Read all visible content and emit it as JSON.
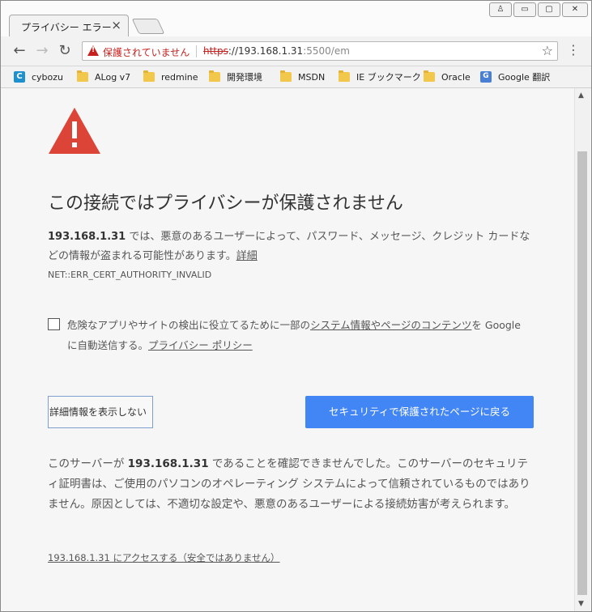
{
  "tab": {
    "title": "プライバシー エラー",
    "close": "×"
  },
  "window_controls": {
    "user": "♙",
    "minimize": "▭",
    "maximize": "▢",
    "close": "✕"
  },
  "toolbar": {
    "back": "←",
    "forward": "→",
    "reload": "↻",
    "security_label": "保護されていません",
    "url_scheme": "https",
    "url_sep": "://",
    "url_host": "193.168.1.31",
    "url_path": ":5500/em",
    "bookmark_star": "☆",
    "menu": "⋮"
  },
  "bookmarks": [
    {
      "label": "cybozu",
      "icon": "cybozu-icon"
    },
    {
      "label": "ALog v7",
      "icon": "folder-icon"
    },
    {
      "label": "redmine",
      "icon": "folder-icon"
    },
    {
      "label": "開発環境",
      "icon": "folder-icon"
    },
    {
      "label": "MSDN",
      "icon": "folder-icon"
    },
    {
      "label": "IE ブックマーク",
      "icon": "folder-icon"
    },
    {
      "label": "Oracle",
      "icon": "folder-icon"
    },
    {
      "label": "Google 翻訳",
      "icon": "google-translate-icon"
    }
  ],
  "interstitial": {
    "heading": "この接続ではプライバシーが保護されません",
    "host": "193.168.1.31",
    "desc_part": " では、悪意のあるユーザーによって、パスワード、メッセージ、クレジット カードなどの情報が盗まれる可能性があります。",
    "details_link": "詳細",
    "error_code": "NET::ERR_CERT_AUTHORITY_INVALID",
    "checkbox_text_1": "危険なアプリやサイトの検出に役立てるために一部の",
    "checkbox_link_1": "システム情報やページのコンテンツ",
    "checkbox_text_2": "を Google に自動送信する。",
    "checkbox_link_2": "プライバシー ポリシー",
    "hide_details_button": "詳細情報を表示しない",
    "back_button": "セキュリティで保護されたページに戻る",
    "explain_1": "このサーバーが ",
    "explain_host": "193.168.1.31",
    "explain_2": " であることを確認できませんでした。このサーバーのセキュリティ証明書は、ご使用のパソコンのオペレーティング システムによって信頼されているものではありません。原因としては、不適切な設定や、悪意のあるユーザーによる接続妨害が考えられます。",
    "proceed_link": "193.168.1.31 にアクセスする（安全ではありません）"
  },
  "colors": {
    "warning_red": "#c5221f",
    "primary_blue": "#4285f4",
    "big_warning": "#db4437"
  }
}
